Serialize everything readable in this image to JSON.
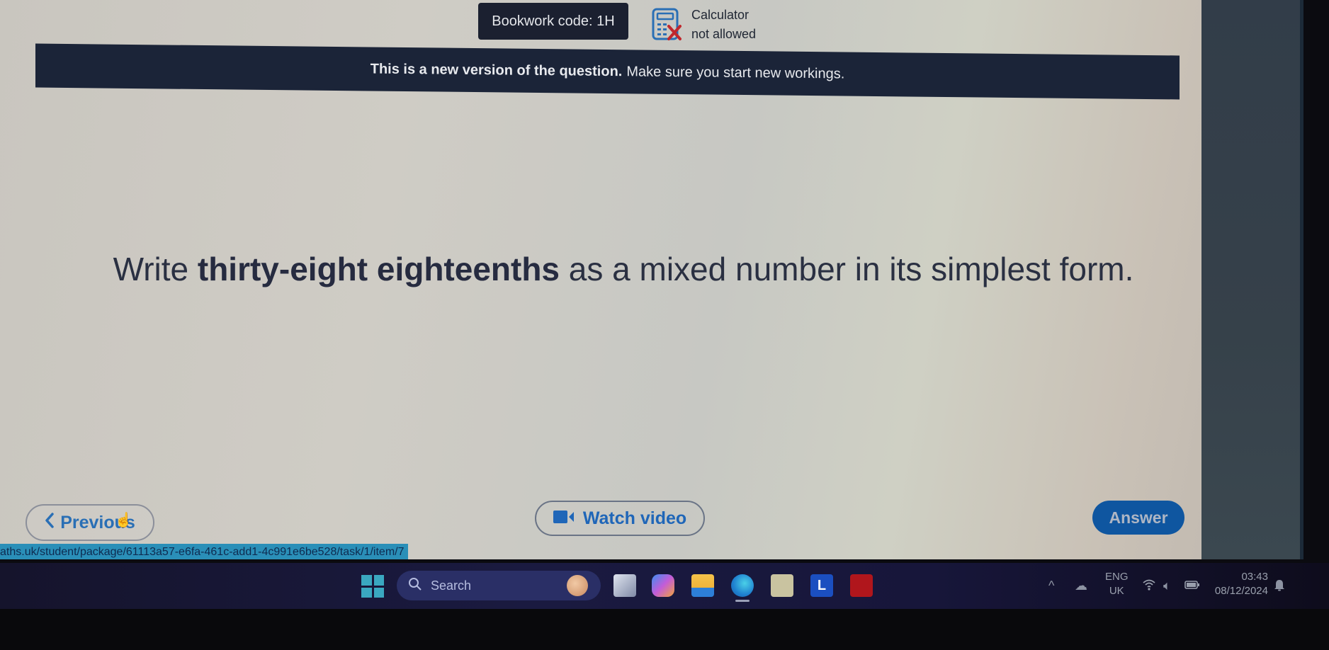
{
  "header": {
    "bookwork_label": "Bookwork code: 1H",
    "calculator_line1": "Calculator",
    "calculator_line2": "not allowed",
    "calculator_icon": "calculator-crossed-icon"
  },
  "notice": {
    "bold": "This is a new version of the question.",
    "rest": "Make sure you start new workings."
  },
  "question": {
    "prefix": "Write ",
    "bold": "thirty-eight eighteenths",
    "suffix": " as a mixed number in its simplest form."
  },
  "buttons": {
    "previous": "Previous",
    "watch_video": "Watch video",
    "answer": "Answer"
  },
  "status_url": "aths.uk/student/package/61113a57-e6fa-461c-add1-4c991e6be528/task/1/item/7",
  "taskbar": {
    "search_placeholder": "Search",
    "apps": [
      "task-view",
      "copilot",
      "file-explorer",
      "edge",
      "microsoft-store",
      "l-app",
      "mcafee"
    ],
    "lang_line1": "ENG",
    "lang_line2": "UK",
    "time": "03:43",
    "date": "08/12/2024"
  },
  "colors": {
    "accent_blue": "#1f66b8",
    "answer_bg": "#0f56a0",
    "banner_bg": "#1b2438",
    "calc_cross": "#c0272d"
  }
}
